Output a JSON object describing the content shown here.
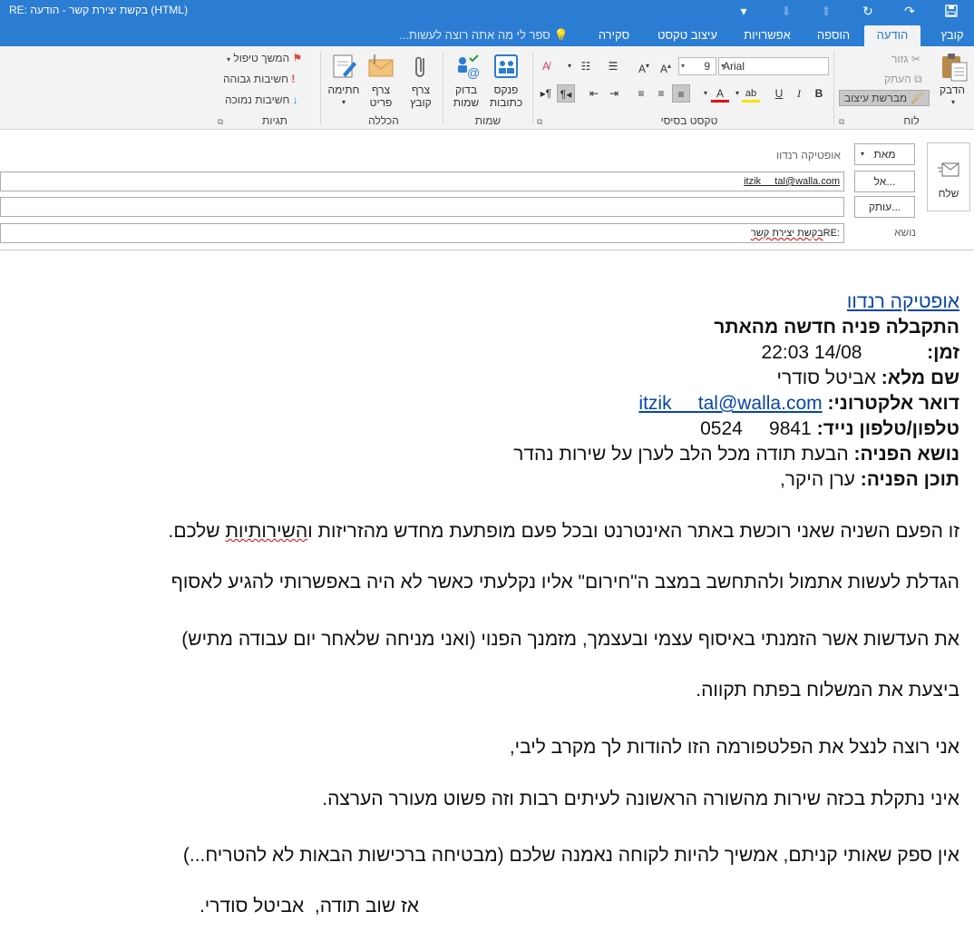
{
  "window": {
    "title": "RE: בקשת יצירת קשר - הודעה (HTML)"
  },
  "ribbon": {
    "tabs": [
      "קובץ",
      "הודעה",
      "הוספה",
      "אפשרויות",
      "עיצוב טקסט",
      "סקירה"
    ],
    "tell_me": "ספר לי מה אתה רוצה לעשות...",
    "clipboard": {
      "paste": "הדבק",
      "cut": "גזור",
      "copy": "העתק",
      "format_painter": "מברשת עיצוב",
      "group": "לוח"
    },
    "basic_text": {
      "font": "Arial",
      "size": "9",
      "group": "טקסט בסיסי"
    },
    "names": {
      "address_book": "פנקס\nכתובות",
      "check_names": "בדוק\nשמות",
      "group": "שמות"
    },
    "include": {
      "attach_file": "צרף\nקובץ",
      "attach_item": "צרף\nפריט",
      "signature": "חתימה",
      "group": "הכללה"
    },
    "tags": {
      "follow_up": "המשך טיפול",
      "high_importance": "חשיבות גבוהה",
      "low_importance": "חשיבות נמוכה",
      "group": "תגיות"
    }
  },
  "header": {
    "send": "שלח",
    "from_button": "מאת",
    "from_value": "אופטיקה רנדוו",
    "to_button": "אל...",
    "to_value": "itzik     tal@walla.com",
    "cc_button": "עותק...",
    "cc_value": "",
    "subject_label": "נושא",
    "subject_prefix": "RE: ",
    "subject_text": "בקשת יצירת קשר"
  },
  "message": {
    "store_link": "אופטיקה רנדוו",
    "heading": "התקבלה פניה חדשה מהאתר",
    "time_label": "זמן:",
    "time_value": "22:03 14/08",
    "name_label": "שם מלא:",
    "name_value": "אביטל סודרי",
    "email_label": "דואר אלקטרוני:",
    "email_value": "itzik     tal@walla.com",
    "phone_label": "טלפון/טלפון נייד:",
    "phone_value": "0524     9841",
    "topic_label": "נושא הפניה:",
    "topic_value": "הבעת תודה מכל הלב לערן על שירות נהדר",
    "content_label": "תוכן הפניה:",
    "content_value": "ערן היקר,",
    "p1_a": "זו הפעם השניה שאני רוכשת באתר האינטרנט ובכל פעם מופתעת מחדש מהזריזות ו",
    "p1_misspelled": "השירותיות",
    "p1_b": " שלכם.",
    "p2": "הגדלת לעשות אתמול ולהתחשב במצב ה\"חירום\" אליו נקלעתי כאשר לא היה באפשרותי להגיע לאסוף",
    "p3": "את העדשות אשר הזמנתי באיסוף עצמי ובעצמך, מזמנך הפנוי (ואני מניחה שלאחר יום עבודה מתיש)",
    "p4": "ביצעת את המשלוח בפתח תקווה.",
    "p5": "אני רוצה לנצל את הפלטפורמה הזו להודות לך מקרב ליבי,",
    "p6": "איני נתקלת בכזה שירות מהשורה הראשונה לעיתים רבות וזה פשוט מעורר הערצה.",
    "p7": "אין ספק שאותי קניתם, אמשיך להיות לקוחה נאמנה שלכם (מבטיחה ברכישות הבאות לא להטריח...)",
    "p8": "אז שוב תודה,  אביטל סודרי."
  },
  "colors": {
    "accent": "#2b7cd3",
    "ribbon_bg": "#f3f3f3",
    "link": "#0645ad"
  }
}
